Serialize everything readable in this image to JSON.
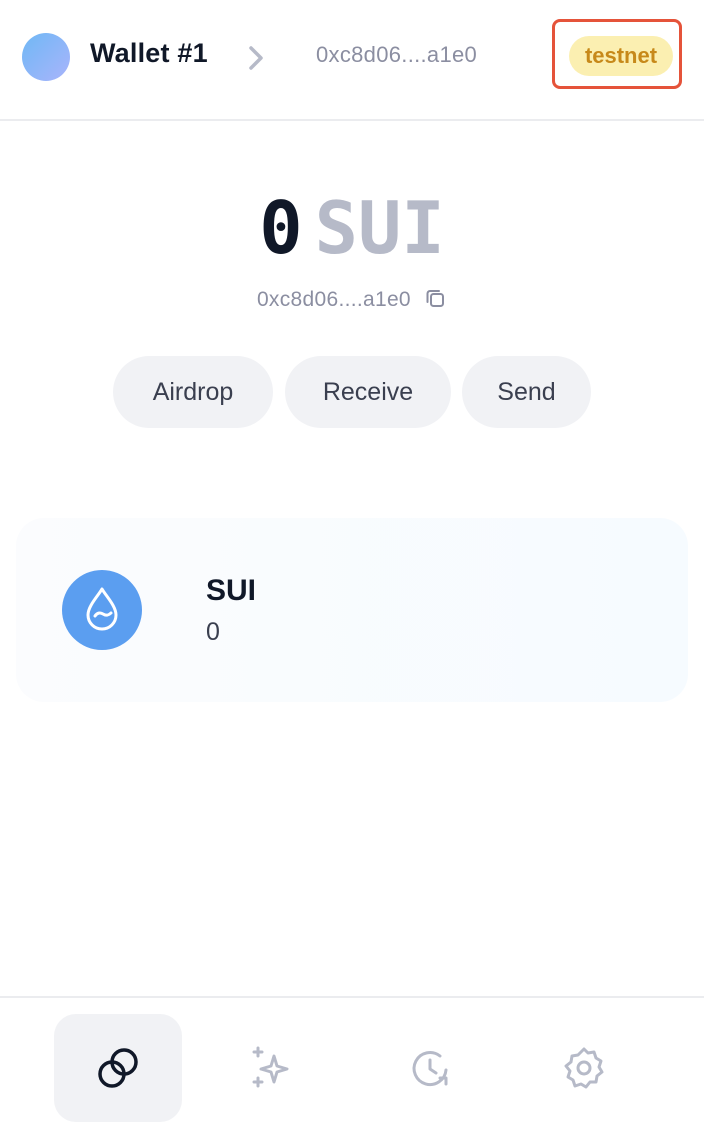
{
  "header": {
    "wallet_name": "Wallet #1",
    "address": "0xc8d06....a1e0",
    "network": "testnet",
    "icons": {
      "avatar": "avatar",
      "chevron": "chevron-right-icon"
    }
  },
  "balance": {
    "amount": "0",
    "symbol": "SUI",
    "address": "0xc8d06....a1e0",
    "copy_icon": "copy-icon"
  },
  "actions": {
    "airdrop": "Airdrop",
    "receive": "Receive",
    "send": "Send"
  },
  "coins": [
    {
      "symbol": "SUI",
      "amount": "0",
      "icon": "sui-drop-icon"
    }
  ],
  "nav": {
    "items": [
      {
        "icon": "tokens-icon",
        "active": true
      },
      {
        "icon": "nfts-sparkle-icon",
        "active": false
      },
      {
        "icon": "activity-history-icon",
        "active": false
      },
      {
        "icon": "settings-gear-icon",
        "active": false
      }
    ]
  },
  "colors": {
    "network_badge_bg": "#fbefb1",
    "network_badge_text": "#c7891a",
    "highlight_frame": "#e5533a",
    "sui_blue": "#5b9ef0",
    "muted_text": "#8b8ea1",
    "button_bg": "#f1f2f5"
  }
}
